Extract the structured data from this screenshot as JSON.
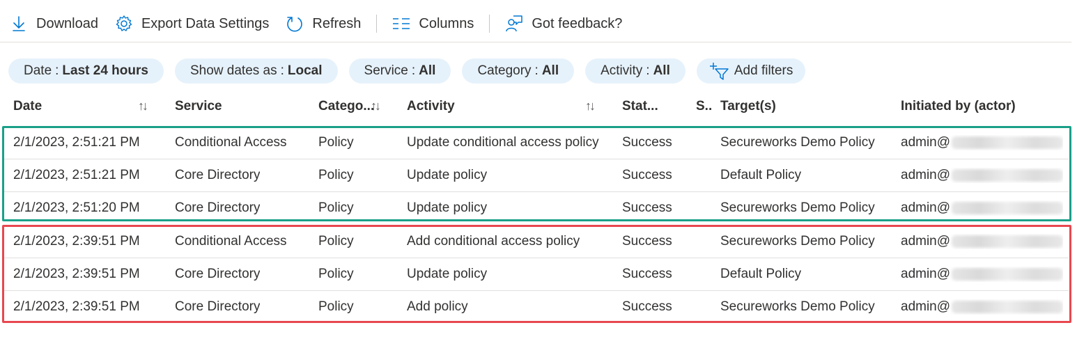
{
  "toolbar": {
    "download": "Download",
    "export": "Export Data Settings",
    "refresh": "Refresh",
    "columns": "Columns",
    "feedback": "Got feedback?"
  },
  "filters": [
    {
      "label": "Date",
      "value": "Last 24 hours"
    },
    {
      "label": "Show dates as",
      "value": "Local"
    },
    {
      "label": "Service",
      "value": "All"
    },
    {
      "label": "Category",
      "value": "All"
    },
    {
      "label": "Activity",
      "value": "All"
    }
  ],
  "add_filters": "Add filters",
  "sort_glyph": "↑↓",
  "columns": {
    "date": "Date",
    "service": "Service",
    "category": "Catego...",
    "activity": "Activity",
    "status": "Stat...",
    "s": "S..",
    "targets": "Target(s)",
    "initiated": "Initiated by (actor)"
  },
  "rows": [
    {
      "date": "2/1/2023, 2:51:21 PM",
      "service": "Conditional Access",
      "category": "Policy",
      "activity": "Update conditional access policy",
      "status": "Success",
      "target": "Secureworks Demo Policy",
      "actor": "admin@"
    },
    {
      "date": "2/1/2023, 2:51:21 PM",
      "service": "Core Directory",
      "category": "Policy",
      "activity": "Update policy",
      "status": "Success",
      "target": "Default Policy",
      "actor": "admin@"
    },
    {
      "date": "2/1/2023, 2:51:20 PM",
      "service": "Core Directory",
      "category": "Policy",
      "activity": "Update policy",
      "status": "Success",
      "target": "Secureworks Demo Policy",
      "actor": "admin@"
    },
    {
      "date": "2/1/2023, 2:39:51 PM",
      "service": "Conditional Access",
      "category": "Policy",
      "activity": "Add conditional access policy",
      "status": "Success",
      "target": "Secureworks Demo Policy",
      "actor": "admin@"
    },
    {
      "date": "2/1/2023, 2:39:51 PM",
      "service": "Core Directory",
      "category": "Policy",
      "activity": "Update policy",
      "status": "Success",
      "target": "Default Policy",
      "actor": "admin@"
    },
    {
      "date": "2/1/2023, 2:39:51 PM",
      "service": "Core Directory",
      "category": "Policy",
      "activity": "Add policy",
      "status": "Success",
      "target": "Secureworks Demo Policy",
      "actor": "admin@"
    }
  ],
  "colors": {
    "accent": "#0078d4",
    "highlight_green": "#1aa089",
    "highlight_red": "#e8474f",
    "pill_bg": "#e6f2fb"
  },
  "icons": {
    "download": "download-icon",
    "export": "gear-icon",
    "refresh": "refresh-icon",
    "columns": "columns-icon",
    "feedback": "feedback-icon",
    "add_filters": "add-filter-icon"
  }
}
